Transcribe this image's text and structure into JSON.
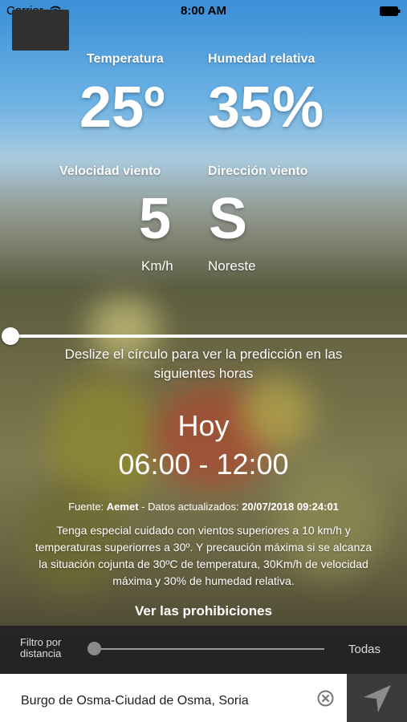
{
  "status": {
    "carrier": "Carrier",
    "time": "8:00 AM"
  },
  "metrics": {
    "temperature": {
      "label": "Temperatura",
      "value": "25º"
    },
    "humidity": {
      "label": "Humedad relativa",
      "value": "35%"
    },
    "wind_speed": {
      "label": "Velocidad viento",
      "value": "5",
      "unit": "Km/h"
    },
    "wind_direction": {
      "label": "Dirección viento",
      "value": "S",
      "unit": "Noreste"
    }
  },
  "forecast": {
    "hint": "Deslize el círculo para ver la predicción en las siguientes horas",
    "day": "Hoy",
    "range": "06:00 - 12:00",
    "source_prefix": "Fuente:",
    "source_name": "Aemet",
    "updated_label": "- Datos actualizados:",
    "updated_value": "20/07/2018 09:24:01",
    "warning": "Tenga especial cuidado con vientos superiores a 10 km/h y temperaturas superiorres a 30º. Y precaución máxima si se alcanza la situación cojunta de 30ºC de temperatura, 30Km/h de velocidad máxima y 30% de humedad relativa.",
    "prohibitions_link": "Ver las prohibiciones",
    "slider_position": 0
  },
  "filter": {
    "label": "Filtro por distancia",
    "value_label": "Todas",
    "slider_position": 0
  },
  "location": {
    "text": "Burgo de Osma-Ciudad de Osma, Soria"
  },
  "colors": {
    "filter_bar": "#232323",
    "location_bar": "#ffffff",
    "nav_button": "#3b3b3b"
  },
  "icons": {
    "wifi": "wifi-icon",
    "battery": "battery-icon",
    "clear": "clear-icon",
    "navigation": "navigation-arrow-icon"
  }
}
